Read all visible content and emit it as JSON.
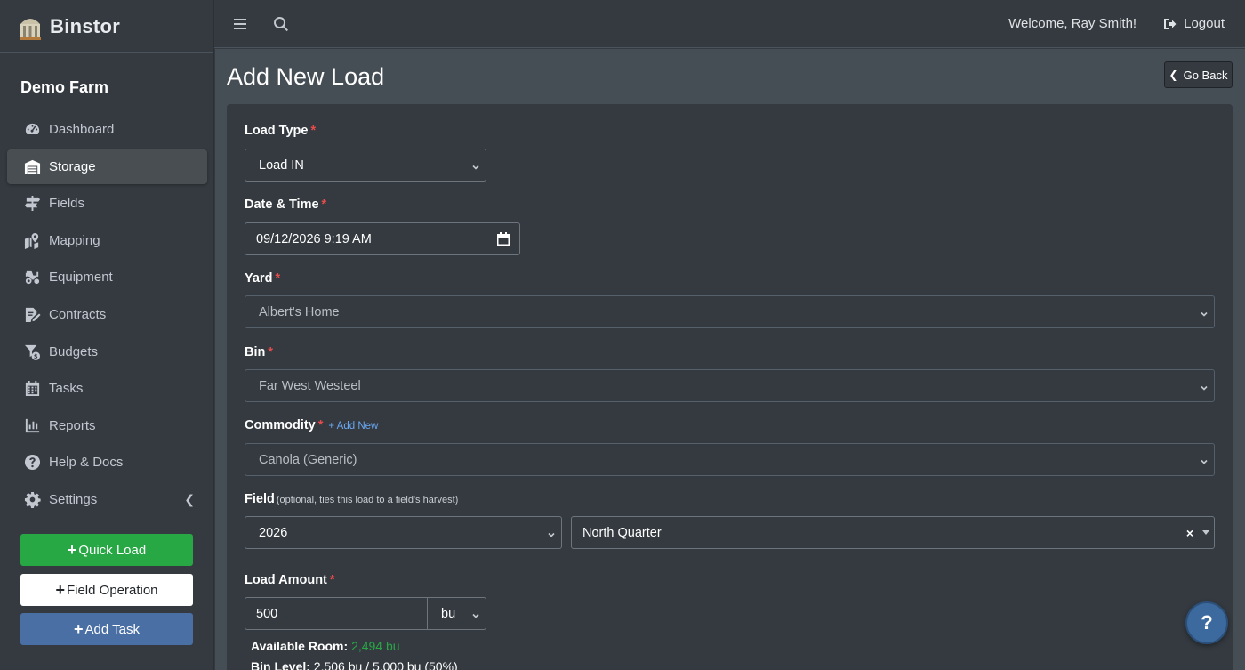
{
  "brand": {
    "name": "Binstor"
  },
  "sidebar": {
    "farm_name": "Demo Farm",
    "items": [
      {
        "label": "Dashboard",
        "icon": "gauge-icon"
      },
      {
        "label": "Storage",
        "icon": "warehouse-icon",
        "active": true
      },
      {
        "label": "Fields",
        "icon": "signpost-icon"
      },
      {
        "label": "Mapping",
        "icon": "map-marker-icon"
      },
      {
        "label": "Equipment",
        "icon": "tractor-icon"
      },
      {
        "label": "Contracts",
        "icon": "file-signature-icon"
      },
      {
        "label": "Budgets",
        "icon": "filter-dollar-icon"
      },
      {
        "label": "Tasks",
        "icon": "calendar-icon"
      },
      {
        "label": "Reports",
        "icon": "bar-chart-icon"
      },
      {
        "label": "Help & Docs",
        "icon": "question-circle-icon"
      },
      {
        "label": "Settings",
        "icon": "gear-icon"
      }
    ],
    "buttons": {
      "quick_load": "Quick Load",
      "field_operation": "Field Operation",
      "add_task": "Add Task"
    }
  },
  "topbar": {
    "welcome": "Welcome, Ray Smith!",
    "logout": "Logout"
  },
  "page": {
    "title": "Add New Load",
    "go_back": "Go Back"
  },
  "form": {
    "load_type": {
      "label": "Load Type",
      "value": "Load IN"
    },
    "date_time": {
      "label": "Date & Time",
      "value": "09/12/2026 9:19 AM"
    },
    "yard": {
      "label": "Yard",
      "value": "Albert's Home"
    },
    "bin": {
      "label": "Bin",
      "value": "Far West Westeel"
    },
    "commodity": {
      "label": "Commodity",
      "add_new": "+ Add New",
      "value": "Canola (Generic)"
    },
    "field": {
      "label": "Field",
      "hint": "(optional, ties this load to a field's harvest)",
      "year": "2026",
      "value": "North Quarter"
    },
    "load_amount": {
      "label": "Load Amount",
      "value": "500",
      "unit": "bu"
    },
    "available_room": {
      "label": "Available Room:",
      "value": "2,494 bu"
    },
    "bin_level": {
      "label": "Bin Level:",
      "value": "2,506 bu / 5,000 bu (50%)"
    }
  },
  "colors": {
    "accent_green": "#28a745",
    "required_red": "#e74c4c",
    "link_blue": "#6aa7f0",
    "task_blue": "#4a6fa5"
  }
}
